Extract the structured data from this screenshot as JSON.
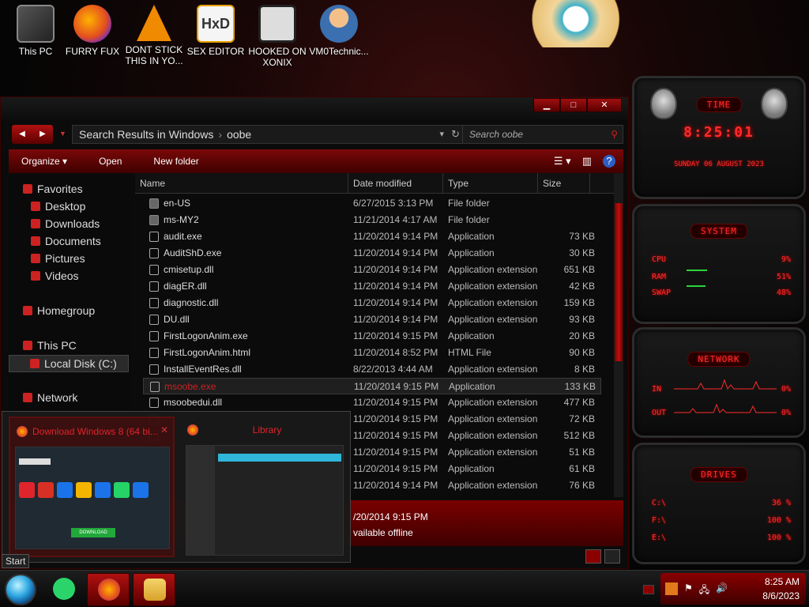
{
  "desktop": {
    "icons": [
      {
        "label": "This PC",
        "icon": "computer-icon"
      },
      {
        "label": "FURRY FUX",
        "icon": "firefox-icon"
      },
      {
        "label": "DONT STICK THIS IN YO...",
        "icon": "vlc-icon"
      },
      {
        "label": "SEX EDITOR",
        "icon": "hxd-icon"
      },
      {
        "label": "HOOKED ON XONIX",
        "icon": "game-icon"
      },
      {
        "label": "VM0Technic...",
        "icon": "person-icon"
      }
    ]
  },
  "explorer": {
    "window_controls": {
      "minimize": "▁",
      "maximize": "□",
      "close": "✕"
    },
    "nav": {
      "back": "◀",
      "forward": "▶",
      "recent": "▼"
    },
    "address": {
      "part1": "Search Results in Windows",
      "separator": "›",
      "part2": "oobe"
    },
    "search": {
      "placeholder": "Search oobe"
    },
    "toolbar": {
      "organize": "Organize ▾",
      "open": "Open",
      "new_folder": "New folder",
      "help": "?"
    },
    "navpane": {
      "favorites": "Favorites",
      "desktop": "Desktop",
      "downloads": "Downloads",
      "documents": "Documents",
      "pictures": "Pictures",
      "videos": "Videos",
      "homegroup": "Homegroup",
      "this_pc": "This PC",
      "local_disk": "Local Disk (C:)",
      "network": "Network"
    },
    "columns": {
      "name": "Name",
      "date": "Date modified",
      "type": "Type",
      "size": "Size"
    },
    "rows": [
      {
        "name": "en-US",
        "date": "6/27/2015 3:13 PM",
        "type": "File folder",
        "size": "",
        "kind": "folder"
      },
      {
        "name": "ms-MY2",
        "date": "11/21/2014 4:17 AM",
        "type": "File folder",
        "size": "",
        "kind": "folder"
      },
      {
        "name": "audit.exe",
        "date": "11/20/2014 9:14 PM",
        "type": "Application",
        "size": "73 KB",
        "kind": "exe"
      },
      {
        "name": "AuditShD.exe",
        "date": "11/20/2014 9:14 PM",
        "type": "Application",
        "size": "30 KB",
        "kind": "exe"
      },
      {
        "name": "cmisetup.dll",
        "date": "11/20/2014 9:14 PM",
        "type": "Application extension",
        "size": "651 KB",
        "kind": "dll"
      },
      {
        "name": "diagER.dll",
        "date": "11/20/2014 9:14 PM",
        "type": "Application extension",
        "size": "42 KB",
        "kind": "dll"
      },
      {
        "name": "diagnostic.dll",
        "date": "11/20/2014 9:14 PM",
        "type": "Application extension",
        "size": "159 KB",
        "kind": "dll"
      },
      {
        "name": "DU.dll",
        "date": "11/20/2014 9:14 PM",
        "type": "Application extension",
        "size": "93 KB",
        "kind": "dll"
      },
      {
        "name": "FirstLogonAnim.exe",
        "date": "11/20/2014 9:15 PM",
        "type": "Application",
        "size": "20 KB",
        "kind": "exe"
      },
      {
        "name": "FirstLogonAnim.html",
        "date": "11/20/2014 8:52 PM",
        "type": "HTML File",
        "size": "90 KB",
        "kind": "html"
      },
      {
        "name": "InstallEventRes.dll",
        "date": "8/22/2013 4:44 AM",
        "type": "Application extension",
        "size": "8 KB",
        "kind": "dll"
      },
      {
        "name": "msoobe.exe",
        "date": "11/20/2014 9:15 PM",
        "type": "Application",
        "size": "133 KB",
        "kind": "exe",
        "selected": true
      },
      {
        "name": "msoobedui.dll",
        "date": "11/20/2014 9:15 PM",
        "type": "Application extension",
        "size": "477 KB",
        "kind": "dll"
      },
      {
        "name": "",
        "date": "11/20/2014 9:15 PM",
        "type": "Application extension",
        "size": "72 KB",
        "kind": "dll"
      },
      {
        "name": "",
        "date": "11/20/2014 9:15 PM",
        "type": "Application extension",
        "size": "512 KB",
        "kind": "dll"
      },
      {
        "name": "",
        "date": "11/20/2014 9:15 PM",
        "type": "Application extension",
        "size": "51 KB",
        "kind": "dll"
      },
      {
        "name": "",
        "date": "11/20/2014 9:15 PM",
        "type": "Application",
        "size": "61 KB",
        "kind": "exe"
      },
      {
        "name": "",
        "date": "11/20/2014 9:14 PM",
        "type": "Application extension",
        "size": "76 KB",
        "kind": "dll"
      }
    ],
    "details": {
      "line1": "/20/2014 9:15 PM",
      "line2": "vailable offline"
    }
  },
  "taskbar_popup": {
    "window1": {
      "title": "Download Windows 8 (64 bi...",
      "close": "✕",
      "button": "DOWNLOAD"
    },
    "window2": {
      "title": "Library"
    }
  },
  "start_tooltip": "Start",
  "gadgets": {
    "time": {
      "title": "TIME",
      "value": "8:25:01",
      "date": "SUNDAY 06 AUGUST 2023"
    },
    "system": {
      "title": "SYSTEM",
      "cpu_label": "CPU",
      "cpu_value": "9%",
      "ram_label": "RAM",
      "ram_value": "51%",
      "swap_label": "SWAP",
      "swap_value": "48%"
    },
    "network": {
      "title": "NETWORK",
      "in_label": "IN",
      "in_value": "0%",
      "out_label": "OUT",
      "out_value": "0%"
    },
    "drives": {
      "title": "DRIVES",
      "c_label": "C:\\",
      "c_value": "36 %",
      "f_label": "F:\\",
      "f_value": "100 %",
      "e_label": "E:\\",
      "e_value": "100 %"
    }
  },
  "clock": {
    "time": "8:25 AM",
    "date": "8/6/2023"
  }
}
